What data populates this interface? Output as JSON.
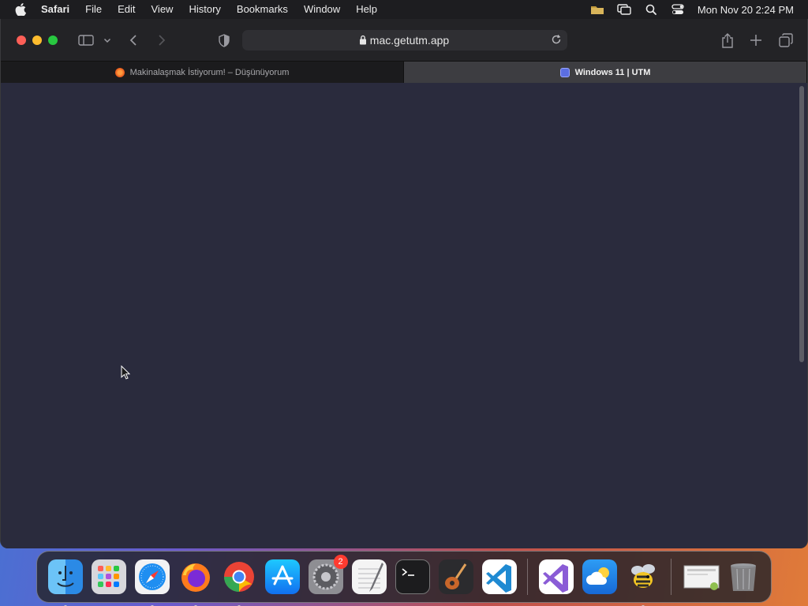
{
  "menubar": {
    "app_name": "Safari",
    "items": [
      "File",
      "Edit",
      "View",
      "History",
      "Bookmarks",
      "Window",
      "Help"
    ],
    "clock": "Mon Nov 20  2:24 PM",
    "status_icons": [
      "folder-icon",
      "screen-mirroring-icon",
      "spotlight-search-icon",
      "control-center-icon"
    ]
  },
  "toolbar": {
    "url": "mac.getutm.app"
  },
  "tabs": [
    {
      "title": "Makinalaşmak İstiyorum! – Düşünüyorum",
      "active": false
    },
    {
      "title": "Windows 11 | UTM",
      "active": true
    }
  ],
  "dock": {
    "apps": [
      {
        "name": "Finder",
        "icon": "finder-icon",
        "running": true
      },
      {
        "name": "Launchpad",
        "icon": "launchpad-icon",
        "running": false
      },
      {
        "name": "Safari",
        "icon": "safari-icon",
        "running": true
      },
      {
        "name": "Firefox",
        "icon": "firefox-icon",
        "running": true
      },
      {
        "name": "Chrome",
        "icon": "chrome-icon",
        "running": true
      },
      {
        "name": "App Store",
        "icon": "app-store-icon",
        "running": false
      },
      {
        "name": "System Settings",
        "icon": "system-settings-icon",
        "running": false,
        "badge": "2"
      },
      {
        "name": "TextEdit",
        "icon": "textedit-icon",
        "running": false
      },
      {
        "name": "Terminal",
        "icon": "terminal-icon",
        "running": true
      },
      {
        "name": "GarageBand",
        "icon": "garageband-icon",
        "running": false
      },
      {
        "name": "VS Code",
        "icon": "vscode-icon",
        "running": false
      },
      {
        "name": "Visual Studio",
        "icon": "visual-studio-icon",
        "running": false
      },
      {
        "name": "Weather",
        "icon": "weather-icon",
        "running": false
      },
      {
        "name": "Bee app",
        "icon": "bee-icon",
        "running": true
      },
      {
        "name": "Screenshot folder",
        "icon": "recent-document-icon",
        "running": false
      },
      {
        "name": "Trash",
        "icon": "trash-icon",
        "running": false
      }
    ],
    "badge_system_settings": "2"
  },
  "colors": {
    "menubar_bg": "#1d1d20",
    "toolbar_bg": "#232326",
    "content_bg": "#2a2b3d",
    "active_tab_bg": "#3d3d41"
  }
}
